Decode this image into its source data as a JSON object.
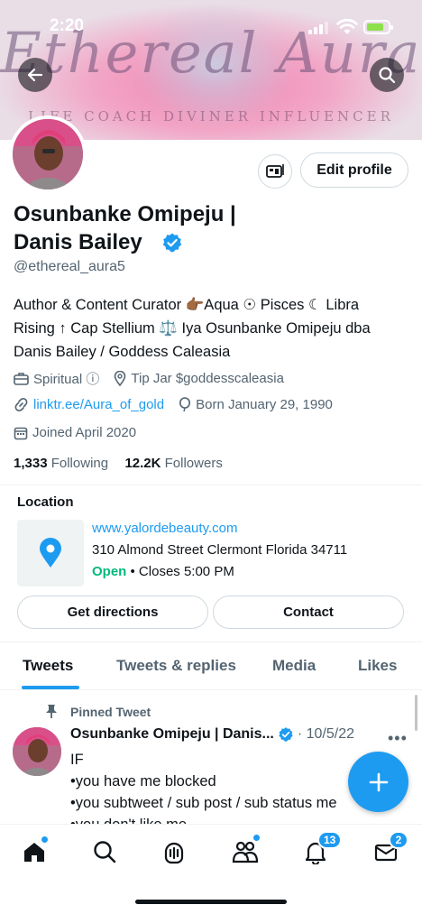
{
  "status_bar": {
    "time": "2:20"
  },
  "banner": {
    "script_text": "Ethereal Aura",
    "subtitle": "LIFE COACH DIVINER INFLUENCER"
  },
  "header": {
    "back_icon": "arrow-left-icon",
    "search_icon": "search-icon"
  },
  "profile": {
    "edit_label": "Edit profile",
    "name_line1": "Osunbanke Omipeju |",
    "name_line2": "Danis Bailey",
    "handle": "@ethereal_aura5",
    "bio_line1": "Author & Content Curator 👉🏾Aqua ☉ Pisces ☾ Libra",
    "bio_line2": "Rising ↑ Cap Stellium ⚖️ Iya Osunbanke Omipeju dba",
    "bio_line3": "Danis Bailey / Goddess Caleasia",
    "category": "Spiritual ⓘ",
    "tip_jar": "Tip Jar $goddesscaleasia",
    "website": "linktr.ee/Aura_of_gold",
    "birthday": "Born January 29, 1990",
    "joined": "Joined April 2020",
    "following_count": "1,333",
    "following_label": "Following",
    "followers_count": "12.2K",
    "followers_label": "Followers"
  },
  "location": {
    "title": "Location",
    "url": "www.yalordebeauty.com",
    "address": "310 Almond Street Clermont Florida 34711",
    "status": "Open",
    "hours": "• Closes 5:00 PM",
    "directions_label": "Get directions",
    "contact_label": "Contact"
  },
  "tabs": [
    "Tweets",
    "Tweets & replies",
    "Media",
    "Likes"
  ],
  "pinned_tweet": {
    "pinned_label": "Pinned Tweet",
    "author": "Osunbanke Omipeju | Danis...",
    "date": "· 10/5/22",
    "more": "•••",
    "lines": [
      "IF",
      "•you have me blocked",
      "•you subtweet / sub post / sub status me",
      "•you don't like me"
    ]
  },
  "tab_bar": {
    "notifications_badge": "13",
    "messages_badge": "2"
  },
  "colors": {
    "accent": "#1d9bf0",
    "open": "#00ba7c"
  }
}
